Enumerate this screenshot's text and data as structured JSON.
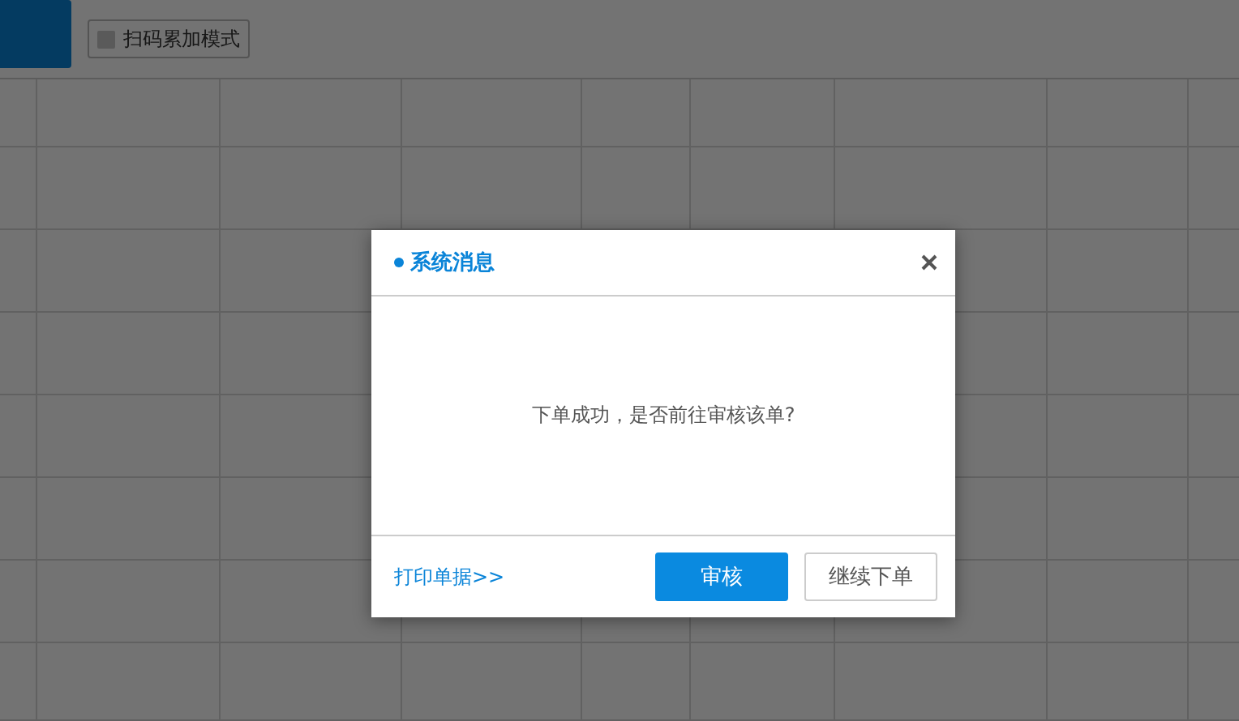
{
  "toolbar": {
    "scan_mode": {
      "label": "扫码累加模式",
      "checked": false
    }
  },
  "dialog": {
    "title": "系统消息",
    "message": "下单成功，是否前往审核该单?",
    "link": "打印单据>>",
    "buttons": [
      {
        "label": "审核",
        "kind": "primary"
      },
      {
        "label": "继续下单",
        "kind": "default"
      }
    ]
  }
}
